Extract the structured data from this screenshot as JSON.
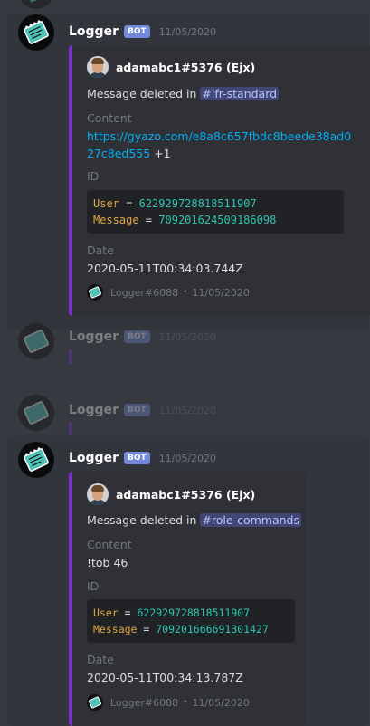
{
  "bot": {
    "name": "Logger",
    "tag": "BOT",
    "date": "11/05/2020",
    "avatar_icon": "notebook-icon"
  },
  "messages": [
    {
      "author": "adamabc1#5376 (Ejx)",
      "desc_prefix": "Message deleted in ",
      "channel": "#lfr-standard",
      "content_label": "Content",
      "content_line1": "https://gyazo.com/e8a8c657fbdc8beede38ad0",
      "content_line2": "27c8ed555",
      "content_suffix": " +1",
      "id_label": "ID",
      "user_key": "User",
      "user_id": "622929728818511907",
      "message_key": "Message",
      "message_id": "709201624509186098",
      "date_label": "Date",
      "date_value": "2020-05-11T00:34:03.744Z",
      "footer_name": "Logger#6088",
      "footer_date": "11/05/2020"
    },
    {
      "author": "adamabc1#5376 (Ejx)",
      "desc_prefix": "Message deleted in ",
      "channel": "#role-commands",
      "content_label": "Content",
      "content_text": "!tob 46",
      "id_label": "ID",
      "user_key": "User",
      "user_id": "622929728818511907",
      "message_key": "Message",
      "message_id": "709201666691301427",
      "date_label": "Date",
      "date_value": "2020-05-11T00:34:13.787Z",
      "footer_name": "Logger#6088",
      "footer_date": "11/05/2020"
    }
  ],
  "colors": {
    "background": "#36393f",
    "embed_bg": "#2f3136",
    "embed_accent": "#7a2ed0",
    "bot_tag": "#7289da",
    "link": "#00aff4",
    "code_key": "#e0a53e",
    "code_num": "#2fc5b0"
  }
}
